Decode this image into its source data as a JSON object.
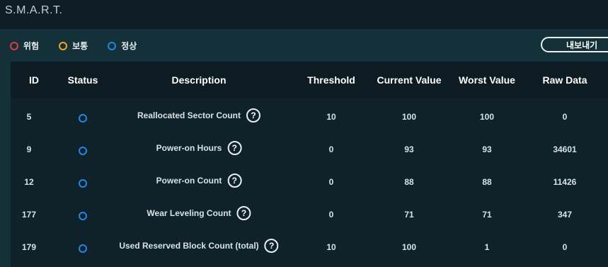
{
  "header": {
    "title": "S.M.A.R.T."
  },
  "legend": [
    {
      "label": "위험",
      "color": "#e0394a"
    },
    {
      "label": "보통",
      "color": "#f5a623"
    },
    {
      "label": "정상",
      "color": "#1e88e5"
    }
  ],
  "toolbar": {
    "export_label": "내보내기"
  },
  "table": {
    "headers": {
      "id": "ID",
      "status": "Status",
      "description": "Description",
      "threshold": "Threshold",
      "current": "Current Value",
      "worst": "Worst Value",
      "raw": "Raw Data"
    },
    "rows": [
      {
        "id": "5",
        "status": "정상",
        "description": "Reallocated Sector Count",
        "threshold": "10",
        "current": "100",
        "worst": "100",
        "raw": "0"
      },
      {
        "id": "9",
        "status": "정상",
        "description": "Power-on Hours",
        "threshold": "0",
        "current": "93",
        "worst": "93",
        "raw": "34601"
      },
      {
        "id": "12",
        "status": "정상",
        "description": "Power-on Count",
        "threshold": "0",
        "current": "88",
        "worst": "88",
        "raw": "11426"
      },
      {
        "id": "177",
        "status": "정상",
        "description": "Wear Leveling Count",
        "threshold": "0",
        "current": "71",
        "worst": "71",
        "raw": "347"
      },
      {
        "id": "179",
        "status": "정상",
        "description": "Used Reserved Block Count (total)",
        "threshold": "10",
        "current": "100",
        "worst": "1",
        "raw": "0"
      }
    ],
    "help_glyph": "?"
  },
  "colors": {
    "status_normal": "#1e88e5",
    "panel_bg": "#143139",
    "page_bg": "#0f1e25"
  }
}
